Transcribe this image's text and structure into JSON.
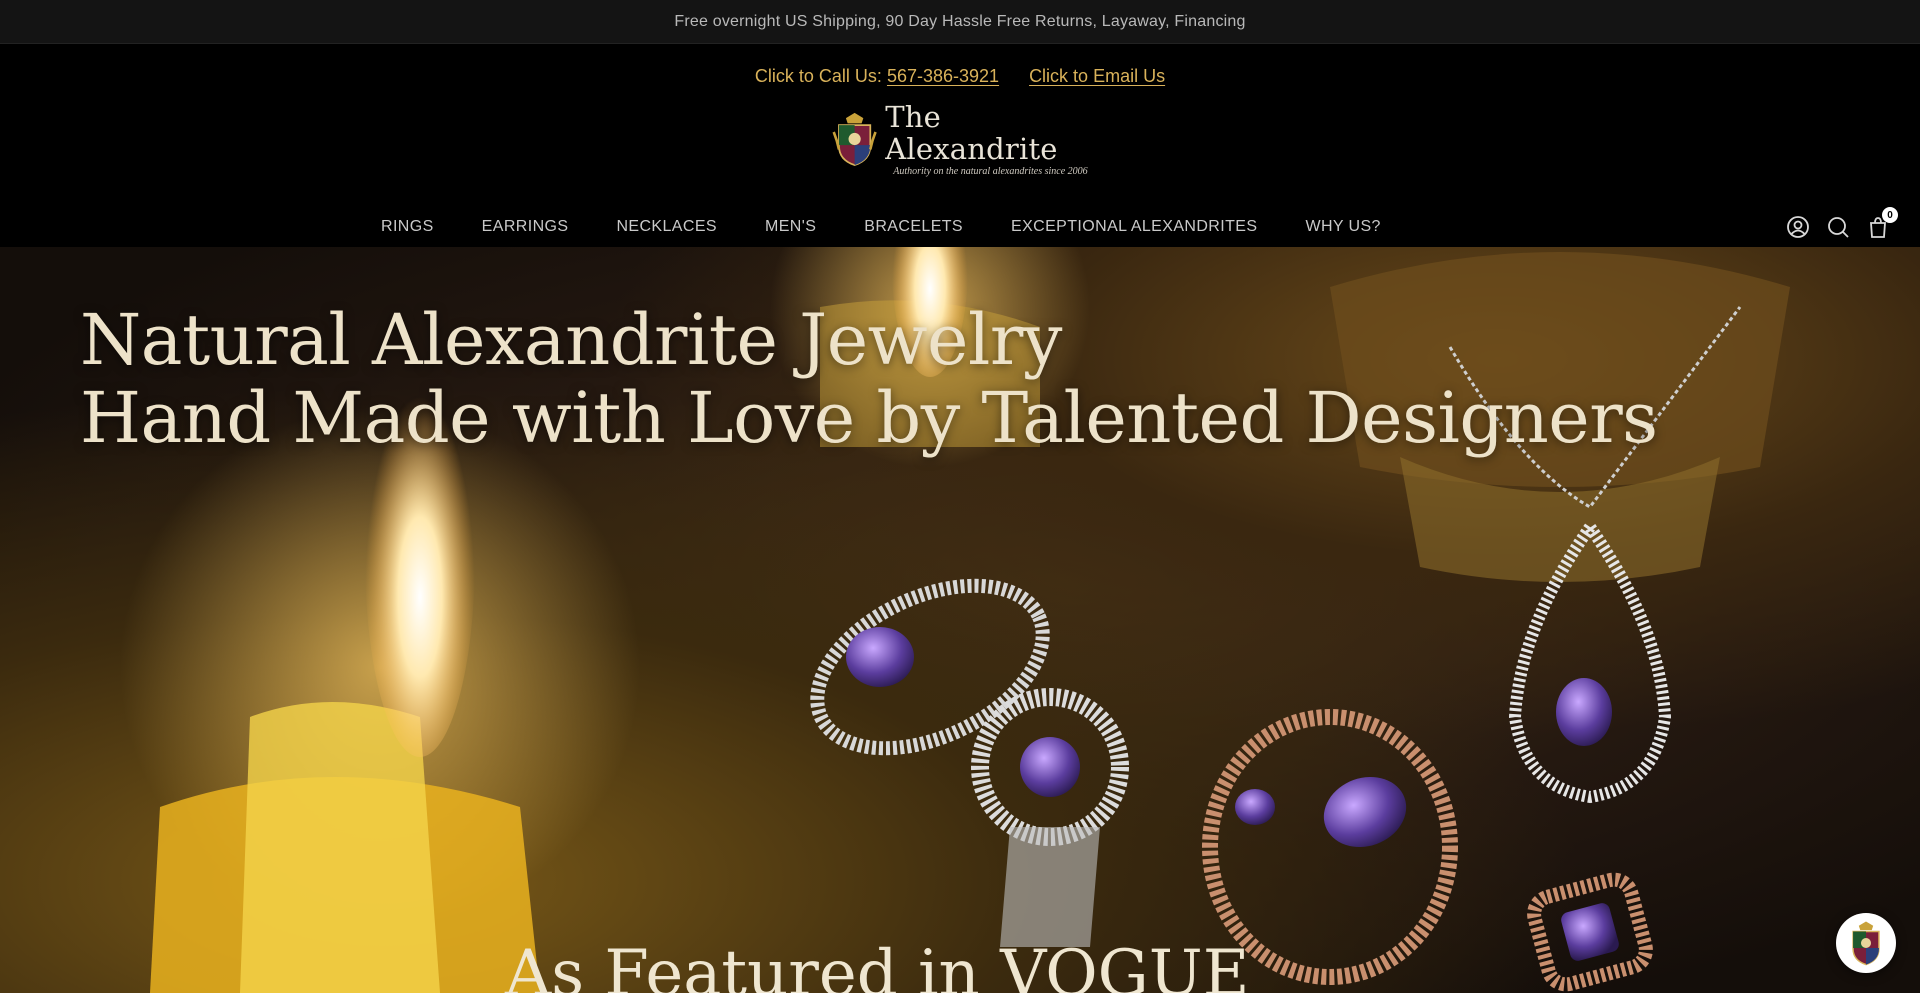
{
  "announcement": "Free overnight US Shipping, 90 Day Hassle Free Returns, Layaway, Financing",
  "contact": {
    "call_prefix": "Click to Call Us:",
    "phone": "567-386-3921",
    "email_label": "Click to Email Us"
  },
  "logo": {
    "name": "The Alexandrite",
    "tagline": "Authority on the natural alexandrites since 2006"
  },
  "nav": {
    "items": [
      {
        "label": "RINGS"
      },
      {
        "label": "EARRINGS"
      },
      {
        "label": "NECKLACES"
      },
      {
        "label": "MEN'S"
      },
      {
        "label": "BRACELETS"
      },
      {
        "label": "EXCEPTIONAL ALEXANDRITES"
      },
      {
        "label": "WHY US?"
      }
    ],
    "icons": [
      "account-icon",
      "search-icon",
      "cart-icon"
    ],
    "cart_count": "0"
  },
  "hero": {
    "line1": "Natural Alexandrite Jewelry",
    "line2": "Hand Made with Love by Talented Designers",
    "featured": "As Featured in VOGUE"
  },
  "colors": {
    "accent_gold": "#d9b25a",
    "hero_text": "#ede2c9",
    "announce_bg": "#141414"
  }
}
